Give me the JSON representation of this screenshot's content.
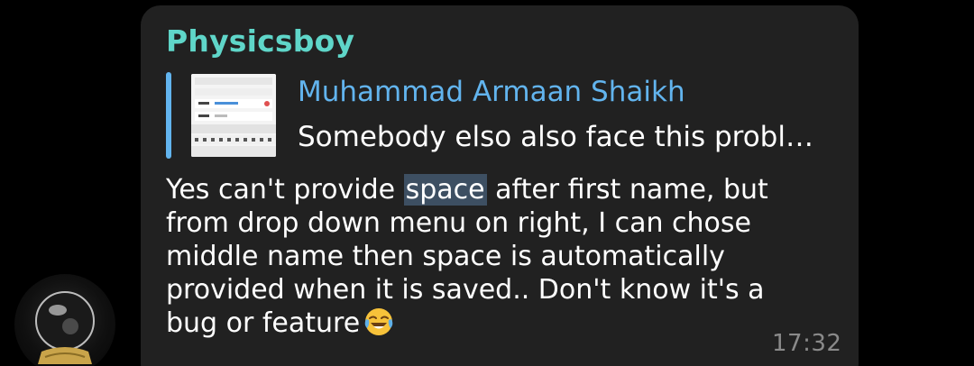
{
  "message": {
    "sender": "Physicsboy",
    "reply": {
      "author": "Muhammad Armaan Shaikh",
      "preview": "Somebody elso also face this probl…",
      "thumbnail_icon": "screenshot-thumbnail"
    },
    "body": {
      "line1_before": "Yes can't provide ",
      "line1_highlight": "space",
      "line1_after": " after first name, but",
      "line2": "from drop down menu on right, I can chose",
      "line3": "middle name then space is automatically",
      "line4": "provided when it is saved.. Don't know it's a",
      "line5": "bug or feature"
    },
    "emoji": "face-with-tears-of-joy",
    "time": "17:32"
  },
  "colors": {
    "background": "#000000",
    "bubble": "#212121",
    "sender_name": "#5fd6c9",
    "reply_accent": "#62b4ee",
    "highlight": "#3d4f62",
    "timestamp": "#8a8a8a"
  },
  "avatar_icon": "crystal-ball-avatar"
}
